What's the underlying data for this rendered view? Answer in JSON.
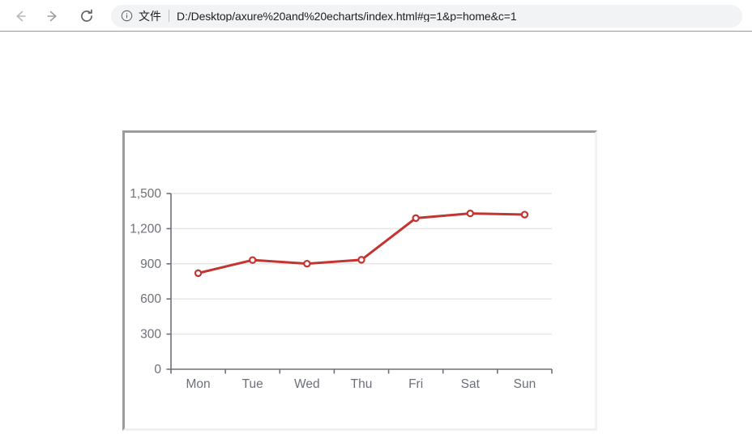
{
  "browser": {
    "back_label": "Back",
    "forward_label": "Forward",
    "reload_label": "Reload",
    "security_icon_label": "info-circle",
    "scheme_label": "文件",
    "url": "D:/Desktop/axure%20and%20echarts/index.html#g=1&p=home&c=1"
  },
  "chart_data": {
    "type": "line",
    "title": "",
    "subtitle": "",
    "xlabel": "",
    "ylabel": "",
    "categories": [
      "Mon",
      "Tue",
      "Wed",
      "Thu",
      "Fri",
      "Sat",
      "Sun"
    ],
    "series": [
      {
        "name": "",
        "values": [
          820,
          932,
          901,
          934,
          1290,
          1330,
          1320
        ],
        "color": "#c23531",
        "marker": "circle-hollow",
        "line_width": 3
      }
    ],
    "ylim": [
      0,
      1500
    ],
    "y_ticks": [
      0,
      300,
      600,
      900,
      1200,
      1500
    ],
    "y_tick_labels": [
      "0",
      "300",
      "600",
      "900",
      "1,200",
      "1,500"
    ],
    "x_tick_labels": [
      "Mon",
      "Tue",
      "Wed",
      "Thu",
      "Fri",
      "Sat",
      "Sun"
    ],
    "grid": true,
    "grid_color": "#e6e6e6",
    "axis_color": "#6e7079",
    "tick_label_color": "#6e7079",
    "legend": null,
    "legend_position": "none"
  }
}
